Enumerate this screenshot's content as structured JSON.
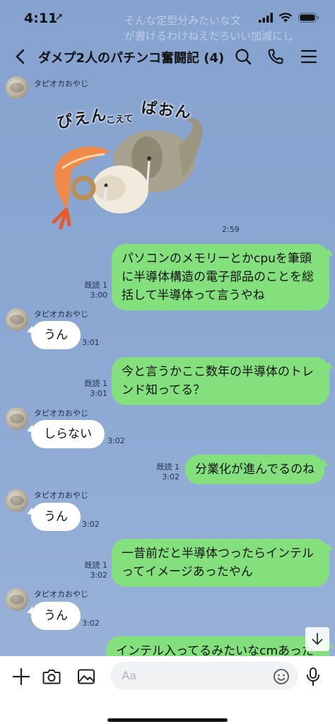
{
  "status": {
    "time": "4:11",
    "location_glyph": "➚"
  },
  "ghost_lines": [
    "そんな定型分みたいな文",
    "が書けるわけねえだろいい加減にし"
  ],
  "header": {
    "title": "ダメプ2人のパチンコ奮闘記 (4)"
  },
  "sticker": {
    "text_1": "ぴえん",
    "text_2": "こえて",
    "text_3": "ぱおん",
    "time": "2:59"
  },
  "sender_name": "タピオカおやじ",
  "messages": [
    {
      "id": "m1",
      "text_lines": [
        "パソコンのメモリーとかcpuを筆頭",
        "に半導体構造の電子部品のことを総",
        "括して半導体って言うやね"
      ],
      "read": "既読 1",
      "time": "3:00"
    },
    {
      "id": "m2",
      "text": "うん",
      "time": "3:01"
    },
    {
      "id": "m3",
      "text_lines": [
        "今と言うかここ数年の半導体のトレ",
        "ンド知ってる？"
      ],
      "read": "既読 1",
      "time": "3:01"
    },
    {
      "id": "m4",
      "text": "しらない",
      "time": "3:02"
    },
    {
      "id": "m5",
      "text": "分業化が進んでるのね",
      "read": "既読 1",
      "time": "3:02"
    },
    {
      "id": "m6",
      "text": "うん",
      "time": "3:02"
    },
    {
      "id": "m7",
      "text_lines": [
        "一昔前だと半導体つったらインテル",
        "ってイメージあったやん"
      ],
      "read": "既読 1",
      "time": "3:02"
    },
    {
      "id": "m8",
      "text": "うん",
      "time": "3:02"
    },
    {
      "id": "m9",
      "text": "インテル入ってるみたいなcmあった"
    }
  ],
  "input": {
    "placeholder": "Aa"
  },
  "colors": {
    "background": "#8aa6d0",
    "outgoing_bubble": "#84e07c",
    "incoming_bubble": "#ffffff",
    "input_bar": "#ffffff"
  }
}
